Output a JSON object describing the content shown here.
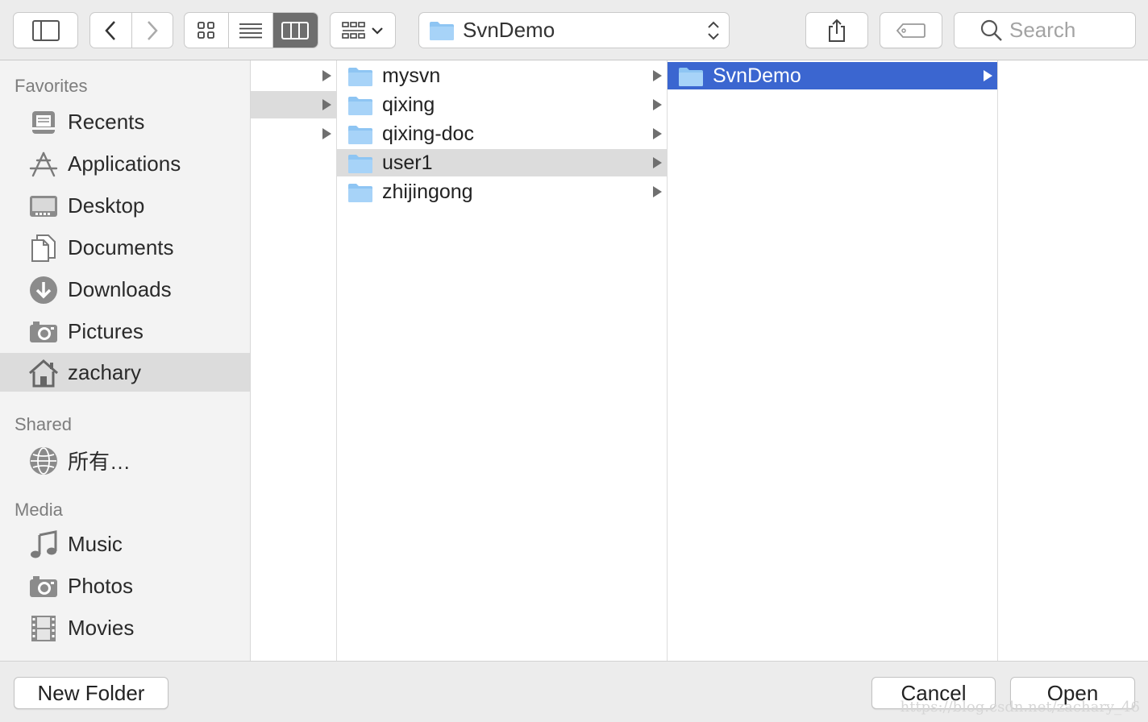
{
  "toolbar": {
    "location": "SvnDemo",
    "search_placeholder": "Search"
  },
  "sidebar": {
    "favorites_heading": "Favorites",
    "favorites": [
      {
        "label": "Recents",
        "icon": "recents-icon"
      },
      {
        "label": "Applications",
        "icon": "applications-icon"
      },
      {
        "label": "Desktop",
        "icon": "desktop-icon"
      },
      {
        "label": "Documents",
        "icon": "documents-icon"
      },
      {
        "label": "Downloads",
        "icon": "downloads-icon"
      },
      {
        "label": "Pictures",
        "icon": "pictures-icon"
      },
      {
        "label": "zachary",
        "icon": "home-icon",
        "selected": true
      }
    ],
    "shared_heading": "Shared",
    "shared": [
      {
        "label": "所有…",
        "icon": "network-icon"
      }
    ],
    "media_heading": "Media",
    "media": [
      {
        "label": "Music",
        "icon": "music-icon"
      },
      {
        "label": "Photos",
        "icon": "photos-icon"
      },
      {
        "label": "Movies",
        "icon": "movies-icon"
      }
    ]
  },
  "columns": {
    "col2": [
      {
        "name": "mysvn"
      },
      {
        "name": "qixing"
      },
      {
        "name": "qixing-doc"
      },
      {
        "name": "user1",
        "highlighted": true
      },
      {
        "name": "zhijingong"
      }
    ],
    "col3": [
      {
        "name": "SvnDemo",
        "selected": true
      }
    ]
  },
  "footer": {
    "new_folder": "New Folder",
    "cancel": "Cancel",
    "open": "Open"
  },
  "watermark": "https://blog.csdn.net/zachary_46",
  "colors": {
    "selection": "#3b66d0",
    "folder": "#8ec5f3"
  }
}
